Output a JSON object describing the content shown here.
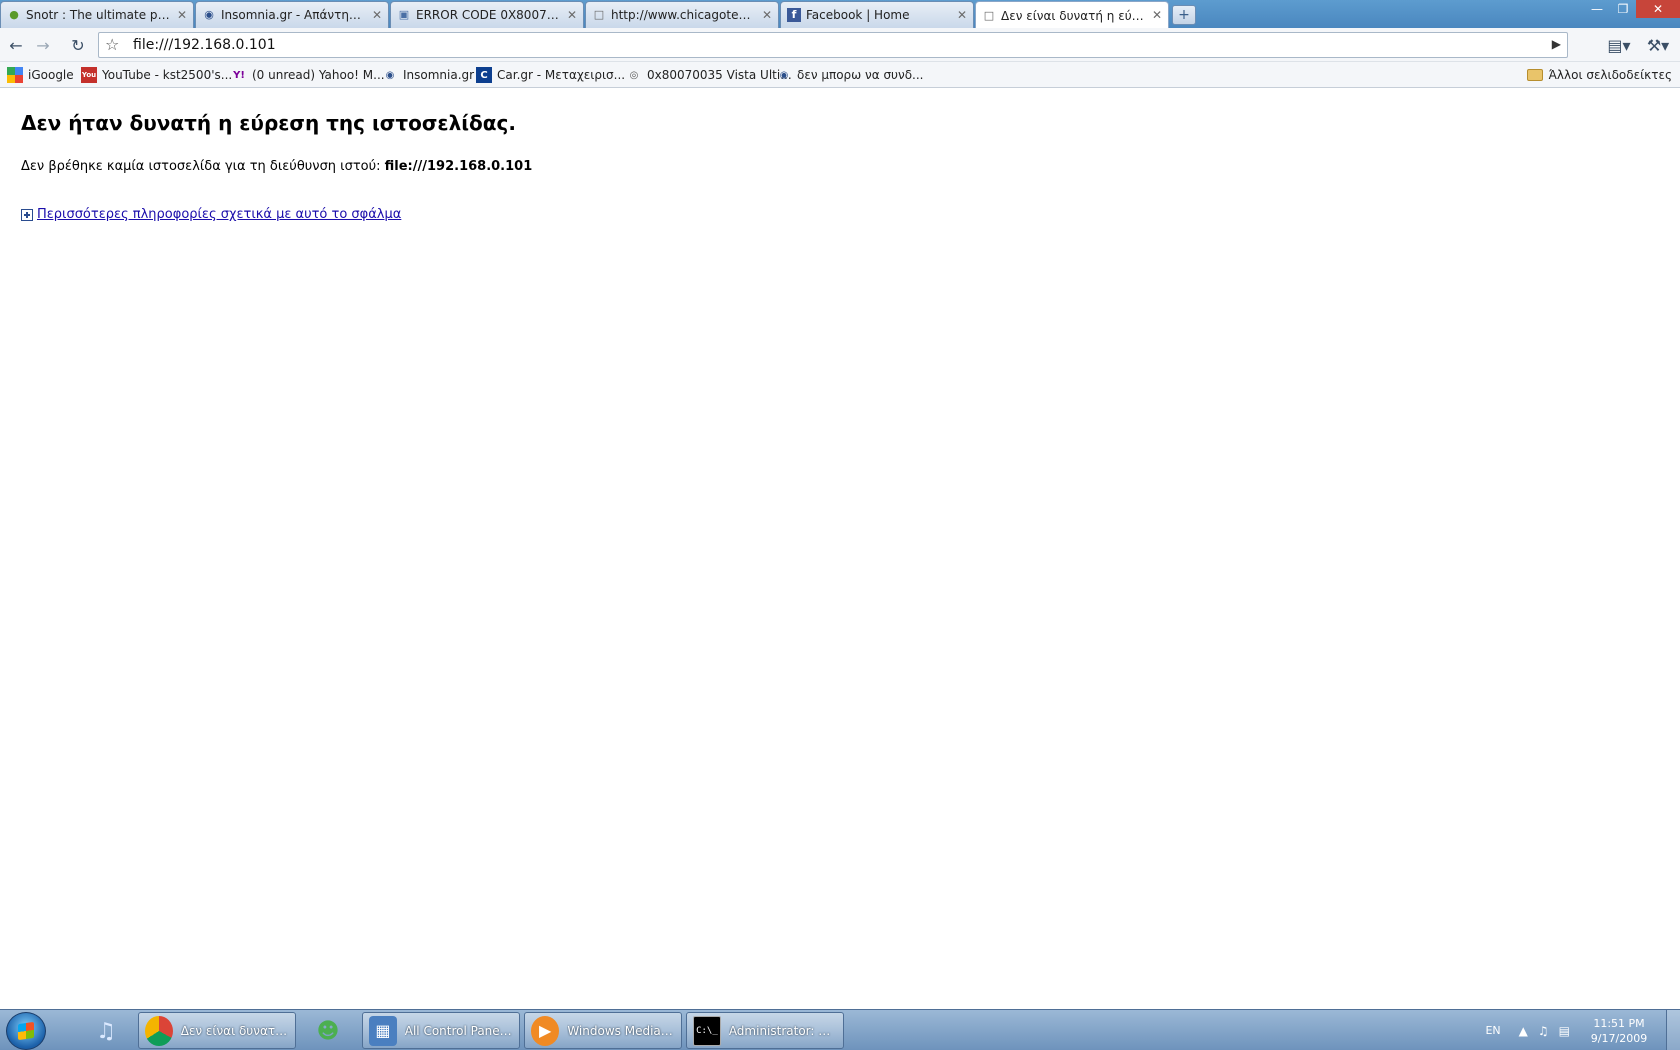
{
  "browser": {
    "tabs": [
      {
        "title": "Snotr : The ultimate plac...",
        "icon": "snotr-favicon",
        "active": false
      },
      {
        "title": "Insomnia.gr - Απάντηση ...",
        "icon": "insomnia-favicon",
        "active": false
      },
      {
        "title": "ERROR CODE 0X80070035",
        "icon": "computer-favicon",
        "active": false
      },
      {
        "title": "http://www.chicagotech....",
        "icon": "page-favicon",
        "active": false
      },
      {
        "title": "Facebook | Home",
        "icon": "facebook-favicon",
        "active": false
      },
      {
        "title": "Δεν είναι δυνατή η εύρεσ...",
        "icon": "page-favicon",
        "active": true
      }
    ],
    "address": "file:///192.168.0.101",
    "bookmarks": [
      {
        "label": "iGoogle",
        "icon": "igoogle-icon"
      },
      {
        "label": "YouTube - kst2500's...",
        "icon": "youtube-icon"
      },
      {
        "label": "(0 unread) Yahoo! M...",
        "icon": "yahoo-icon"
      },
      {
        "label": "Insomnia.gr",
        "icon": "insomnia-icon"
      },
      {
        "label": "Car.gr - Μεταχειρισ...",
        "icon": "cargr-icon"
      },
      {
        "label": "0x80070035 Vista Ulti...",
        "icon": "globe-icon"
      },
      {
        "label": "δεν μπορω να συνδ...",
        "icon": "insomnia-icon"
      }
    ],
    "other_bookmarks": "Άλλοι σελιδοδείκτες"
  },
  "page": {
    "title": "Δεν ήταν δυνατή η εύρεση της ιστοσελίδας.",
    "desc_prefix": "Δεν βρέθηκε καμία ιστοσελίδα για τη διεύθυνση ιστού:",
    "desc_url": "file:///192.168.0.101",
    "more_link": "Περισσότερες πληροφορίες σχετικά με αυτό το σφάλμα"
  },
  "taskbar": {
    "tasks": [
      {
        "label": "Δεν είναι δυνατή ...",
        "icon": "chrome-icon"
      },
      {
        "label": "All Control Panel I...",
        "icon": "control-panel-icon"
      },
      {
        "label": "Windows Media P...",
        "icon": "media-player-icon"
      },
      {
        "label": "Administrator: C:\\...",
        "icon": "cmd-icon"
      }
    ],
    "lang": "EN",
    "time": "11:51 PM",
    "date": "9/17/2009"
  }
}
